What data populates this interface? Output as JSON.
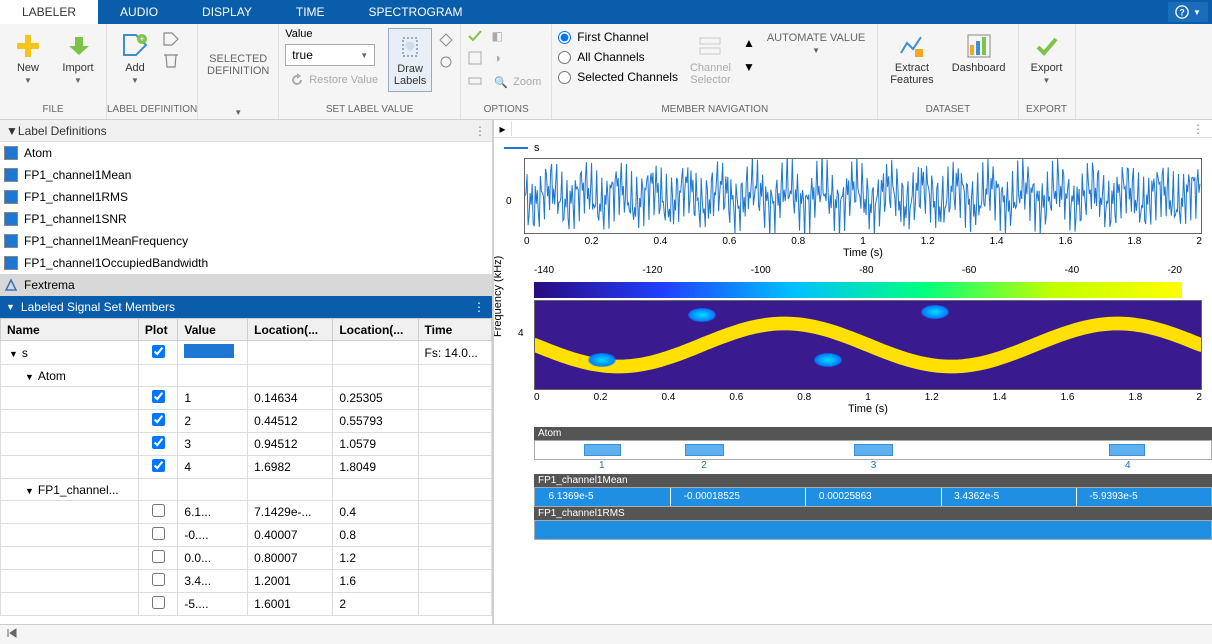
{
  "tabs": [
    "LABELER",
    "AUDIO",
    "DISPLAY",
    "TIME",
    "SPECTROGRAM"
  ],
  "active_tab": 0,
  "ribbon": {
    "file": {
      "label": "FILE",
      "new": "New",
      "import": "Import"
    },
    "labeldef": {
      "label": "LABEL DEFINITION",
      "add": "Add"
    },
    "selected_def": {
      "label": "SELECTED\nDEFINITION"
    },
    "setval": {
      "label": "SET LABEL VALUE",
      "value_lbl": "Value",
      "value": "true",
      "restore": "Restore Value",
      "draw": "Draw\nLabels"
    },
    "options": {
      "label": "OPTIONS",
      "zoom": "Zoom"
    },
    "member_nav": {
      "label": "MEMBER NAVIGATION",
      "first": "First Channel",
      "all": "All Channels",
      "sel": "Selected Channels",
      "chsel": "Channel\nSelector",
      "auto": "AUTOMATE VALUE"
    },
    "dataset": {
      "label": "DATASET",
      "extract": "Extract\nFeatures",
      "dash": "Dashboard"
    },
    "export": {
      "label": "EXPORT",
      "export": "Export"
    }
  },
  "defs_title": "Label Definitions",
  "defs": [
    {
      "name": "Atom"
    },
    {
      "name": "FP1_channel1Mean"
    },
    {
      "name": "FP1_channel1RMS"
    },
    {
      "name": "FP1_channel1SNR"
    },
    {
      "name": "FP1_channel1MeanFrequency"
    },
    {
      "name": "FP1_channel1OccupiedBandwidth"
    },
    {
      "name": "Fextrema",
      "tri": true,
      "sel": true
    }
  ],
  "members_title": "Labeled Signal Set Members",
  "cols": [
    "Name",
    "Plot",
    "Value",
    "Location(...",
    "Location(...",
    "Time"
  ],
  "rows": [
    {
      "indent": 0,
      "expander": "▼",
      "name": "s",
      "plot": true,
      "value_swatch": true,
      "time": "Fs: 14.0..."
    },
    {
      "indent": 1,
      "expander": "▼",
      "name": "Atom"
    },
    {
      "indent": 2,
      "plot": true,
      "value": "1",
      "loc1": "0.14634",
      "loc2": "0.25305"
    },
    {
      "indent": 2,
      "plot": true,
      "value": "2",
      "loc1": "0.44512",
      "loc2": "0.55793"
    },
    {
      "indent": 2,
      "plot": true,
      "value": "3",
      "loc1": "0.94512",
      "loc2": "1.0579"
    },
    {
      "indent": 2,
      "plot": true,
      "value": "4",
      "loc1": "1.6982",
      "loc2": "1.8049"
    },
    {
      "indent": 1,
      "expander": "▼",
      "name": "FP1_channel..."
    },
    {
      "indent": 2,
      "plot": false,
      "value": "6.1...",
      "loc1": "7.1429e-...",
      "loc2": "0.4"
    },
    {
      "indent": 2,
      "plot": false,
      "value": "-0....",
      "loc1": "0.40007",
      "loc2": "0.8"
    },
    {
      "indent": 2,
      "plot": false,
      "value": "0.0...",
      "loc1": "0.80007",
      "loc2": "1.2"
    },
    {
      "indent": 2,
      "plot": false,
      "value": "3.4...",
      "loc1": "1.2001",
      "loc2": "1.6"
    },
    {
      "indent": 2,
      "plot": false,
      "value": "-5....",
      "loc1": "1.6001",
      "loc2": "2"
    }
  ],
  "legend_s": "s",
  "chart_data": {
    "waveform": {
      "type": "line",
      "xlabel": "Time (s)",
      "ylabel": "",
      "xlim": [
        0,
        2
      ],
      "ticks": [
        "0",
        "0.2",
        "0.4",
        "0.6",
        "0.8",
        "1",
        "1.2",
        "1.4",
        "1.6",
        "1.8",
        "2"
      ],
      "y0": "0"
    },
    "colorbar": {
      "ticks": [
        "-140",
        "-120",
        "-100",
        "-80",
        "-60",
        "-40",
        "-20"
      ]
    },
    "spectrogram": {
      "type": "heatmap",
      "xlabel": "Time (s)",
      "ylabel": "Frequency (kHz)",
      "xlim": [
        0,
        2
      ],
      "ylim": [
        0,
        6
      ],
      "xticks": [
        "0",
        "0.2",
        "0.4",
        "0.6",
        "0.8",
        "1",
        "1.2",
        "1.4",
        "1.6",
        "1.8",
        "2"
      ],
      "ytick": "4",
      "blobs": [
        [
          0.2,
          2
        ],
        [
          0.5,
          5
        ],
        [
          0.88,
          2
        ],
        [
          1.2,
          5.2
        ]
      ]
    },
    "atom_track": {
      "title": "Atom",
      "bars": [
        {
          "x": 0.14634,
          "w": 0.107,
          "n": "1"
        },
        {
          "x": 0.44512,
          "w": 0.113,
          "n": "2"
        },
        {
          "x": 0.94512,
          "w": 0.113,
          "n": "3"
        },
        {
          "x": 1.6982,
          "w": 0.107,
          "n": "4"
        }
      ]
    },
    "mean_track": {
      "title": "FP1_channel1Mean",
      "vals": [
        "6.1369e-5",
        "-0.00018525",
        "0.00025863",
        "3.4362e-5",
        "-5.9393e-5"
      ]
    },
    "rms_track": {
      "title": "FP1_channel1RMS"
    }
  }
}
